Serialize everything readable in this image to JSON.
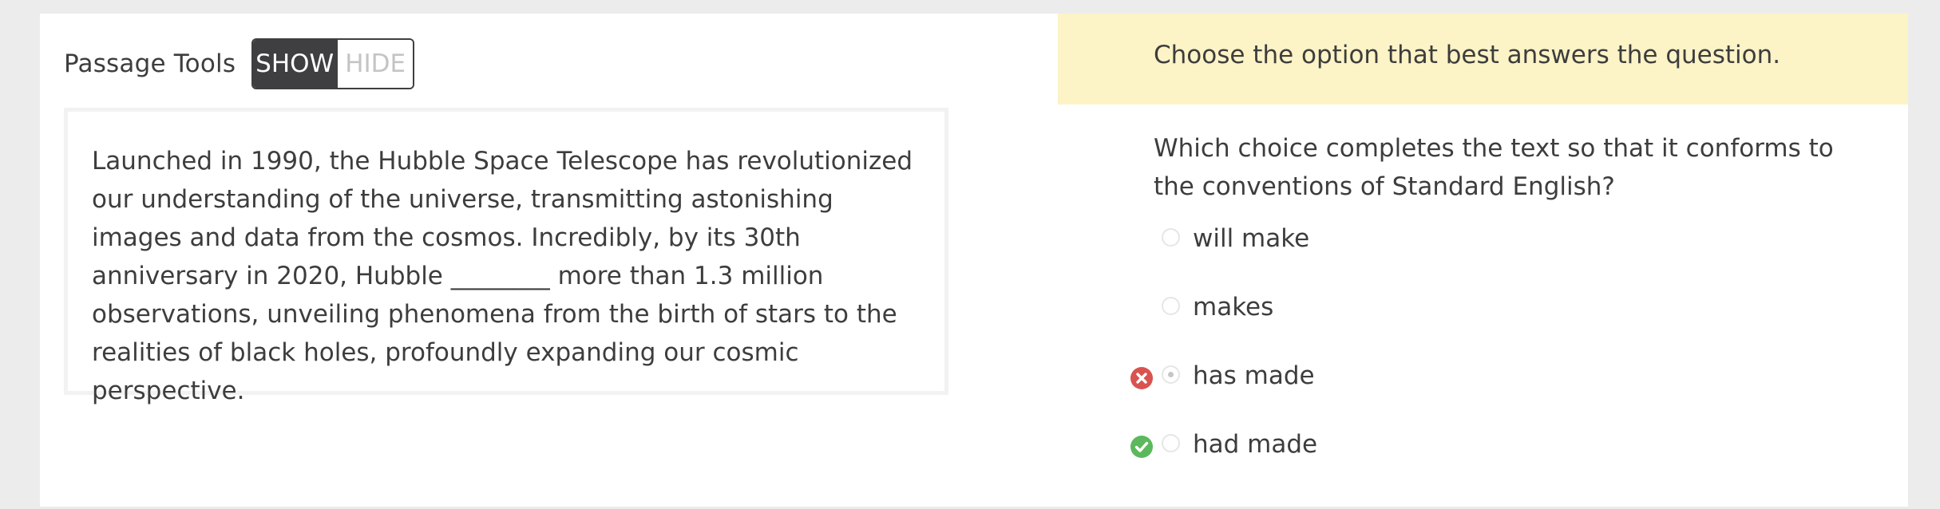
{
  "passage_tools": {
    "label": "Passage Tools",
    "show_label": "SHOW",
    "hide_label": "HIDE",
    "selected": "SHOW"
  },
  "passage": {
    "text": "Launched in 1990, the Hubble Space Telescope has revolutionized our understanding of the universe, transmitting astonishing images and data from the cosmos. Incredibly, by its 30th anniversary in 2020, Hubble ________ more than 1.3 million observations, unveiling phenomena from the birth of stars to the realities of black holes, profoundly expanding our cosmic perspective."
  },
  "instruction": "Choose the option that best answers the question.",
  "question": "Which choice completes the text so that it conforms to the conventions of Standard English?",
  "options": [
    {
      "label": "will make",
      "selected": false,
      "status": "none"
    },
    {
      "label": "makes",
      "selected": false,
      "status": "none"
    },
    {
      "label": "has made",
      "selected": true,
      "status": "incorrect"
    },
    {
      "label": "had made",
      "selected": false,
      "status": "correct"
    }
  ],
  "colors": {
    "incorrect": "#d9534f",
    "correct": "#5cb85c",
    "instruction_bg": "#fcf3c6",
    "toggle_active": "#3f3f42"
  }
}
